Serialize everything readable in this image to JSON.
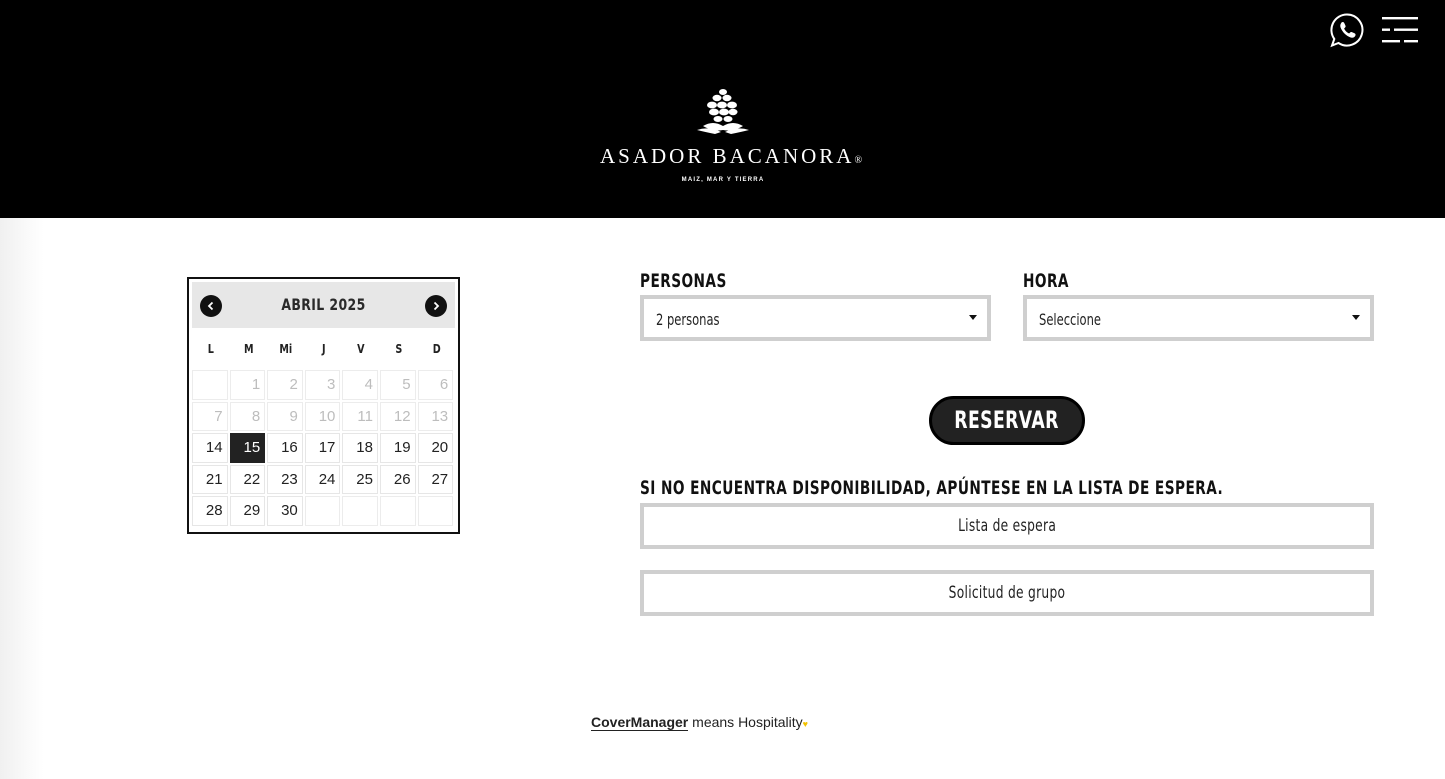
{
  "header": {
    "brand_name": "ASADOR BACANORA",
    "brand_mark": "®",
    "brand_tagline": "MAIZ, MAR Y TIERRA",
    "whatsapp_icon": "whatsapp-icon",
    "menu_icon": "hamburger-menu-icon"
  },
  "calendar": {
    "title": "ABRIL 2025",
    "prev_icon": "chevron-left-icon",
    "next_icon": "chevron-right-icon",
    "weekdays": [
      "L",
      "M",
      "Mi",
      "J",
      "V",
      "S",
      "D"
    ],
    "weeks": [
      [
        "",
        "1",
        "2",
        "3",
        "4",
        "5",
        "6"
      ],
      [
        "7",
        "8",
        "9",
        "10",
        "11",
        "12",
        "13"
      ],
      [
        "14",
        "15",
        "16",
        "17",
        "18",
        "19",
        "20"
      ],
      [
        "21",
        "22",
        "23",
        "24",
        "25",
        "26",
        "27"
      ],
      [
        "28",
        "29",
        "30",
        "",
        "",
        "",
        ""
      ]
    ],
    "selected": "15",
    "first_available": "14"
  },
  "form": {
    "personas_label": "PERSONAS",
    "personas_value": "2 personas",
    "hora_label": "HORA",
    "hora_value": "Seleccione",
    "reservar_label": "RESERVAR",
    "waitlist_notice": "SI NO ENCUENTRA DISPONIBILIDAD, APÚNTESE EN LA LISTA DE ESPERA.",
    "waitlist_button": "Lista de espera",
    "group_button": "Solicitud de grupo"
  },
  "footer": {
    "brand_link": "CoverManager",
    "tagline": " means Hospitality",
    "heart": "♥"
  },
  "colors": {
    "header_bg": "#000000",
    "accent_heart": "#f2c200",
    "selected_day_bg": "#222222"
  }
}
